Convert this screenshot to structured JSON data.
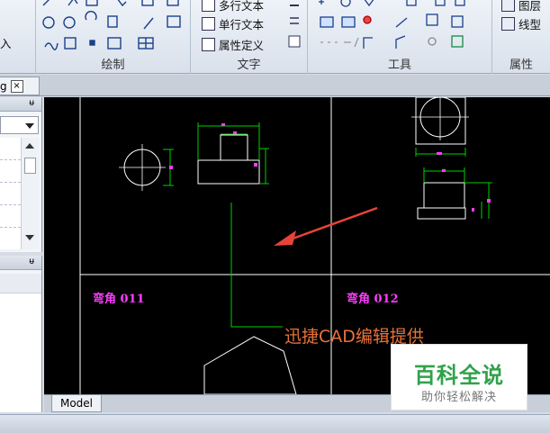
{
  "ribbon": {
    "left_partial_label": "入",
    "panels": {
      "draw": {
        "title": "绘制"
      },
      "text": {
        "title": "文字",
        "buttons": [
          "多行文本",
          "单行文本",
          "属性定义"
        ]
      },
      "tools": {
        "title": "工具"
      },
      "properties": {
        "title": "属性",
        "buttons": [
          "图层",
          "线型"
        ]
      }
    }
  },
  "document_tab": {
    "label": "g",
    "close_glyph": "×"
  },
  "palettes": {
    "pin_glyph": "ᵾ"
  },
  "drawing": {
    "labels": [
      "弯角 011",
      "弯角 012"
    ],
    "annotation": "迅捷CAD编辑提供",
    "colors": {
      "background": "#000000",
      "geometry": "#ffffff",
      "dimension": "#00d000",
      "label": "#ff3cff",
      "arrow": "#e8433a",
      "annotation": "#e8733a"
    }
  },
  "layout_tabs": {
    "model": "Model"
  },
  "watermark": {
    "title": "百科全说",
    "subtitle": "助你轻松解决"
  }
}
